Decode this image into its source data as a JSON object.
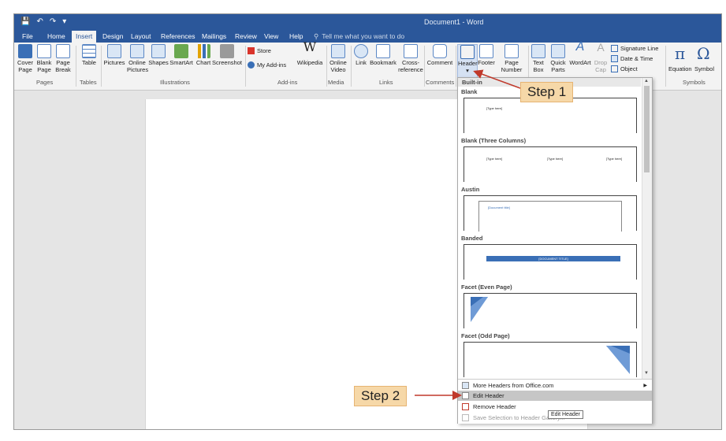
{
  "window": {
    "title": "Document1 - Word",
    "qat": [
      "save-icon",
      "undo-icon",
      "redo-icon",
      "customize-icon"
    ]
  },
  "menu": {
    "tabs": [
      "File",
      "Home",
      "Insert",
      "Design",
      "Layout",
      "References",
      "Mailings",
      "Review",
      "View",
      "Help"
    ],
    "active": "Insert",
    "tell_me": "Tell me what you want to do"
  },
  "ribbon": {
    "pages": {
      "cover": "Cover Page",
      "blank": "Blank Page",
      "break": "Page Break",
      "label": "Pages"
    },
    "tables": {
      "table": "Table",
      "label": "Tables"
    },
    "illustrations": {
      "pictures": "Pictures",
      "online_pictures": "Online Pictures",
      "shapes": "Shapes",
      "smartart": "SmartArt",
      "chart": "Chart",
      "screenshot": "Screenshot",
      "label": "Illustrations"
    },
    "addins": {
      "store": "Store",
      "my_addins": "My Add-ins",
      "wikipedia": "Wikipedia",
      "label": "Add-ins"
    },
    "media": {
      "online_video": "Online Video",
      "label": "Media"
    },
    "links": {
      "link": "Link",
      "bookmark": "Bookmark",
      "cross_reference": "Cross-reference",
      "label": "Links"
    },
    "comments": {
      "comment": "Comment",
      "label": "Comments"
    },
    "header_footer": {
      "header": "Header",
      "footer": "Footer",
      "page_number": "Page Number"
    },
    "text": {
      "text_box": "Text Box",
      "quick_parts": "Quick Parts",
      "wordart": "WordArt",
      "drop_cap": "Drop Cap",
      "signature_line": "Signature Line",
      "date_time": "Date & Time",
      "object": "Object"
    },
    "symbols": {
      "equation": "Equation",
      "symbol": "Symbol",
      "label": "Symbols"
    }
  },
  "gallery": {
    "section": "Built-in",
    "items": [
      {
        "title": "Blank",
        "thumb_text": "[Type here]"
      },
      {
        "title": "Blank (Three Columns)",
        "thumb_text": "[Type here]"
      },
      {
        "title": "Austin",
        "thumb_text": "[Document title]"
      },
      {
        "title": "Banded",
        "thumb_text": "[DOCUMENT TITLE]"
      },
      {
        "title": "Facet (Even Page)",
        "thumb_text": ""
      },
      {
        "title": "Facet (Odd Page)",
        "thumb_text": ""
      }
    ],
    "menu": [
      {
        "label": "More Headers from Office.com",
        "state": "normal"
      },
      {
        "label": "Edit Header",
        "state": "highlighted"
      },
      {
        "label": "Remove Header",
        "state": "normal"
      },
      {
        "label": "Save Selection to Header Gallery...",
        "state": "disabled"
      }
    ],
    "tooltip": "Edit Header"
  },
  "annotations": {
    "step1": "Step 1",
    "step2": "Step 2"
  },
  "colors": {
    "accent": "#2b579a",
    "callout": "#f6d8a8",
    "arrow": "#c0392b"
  }
}
